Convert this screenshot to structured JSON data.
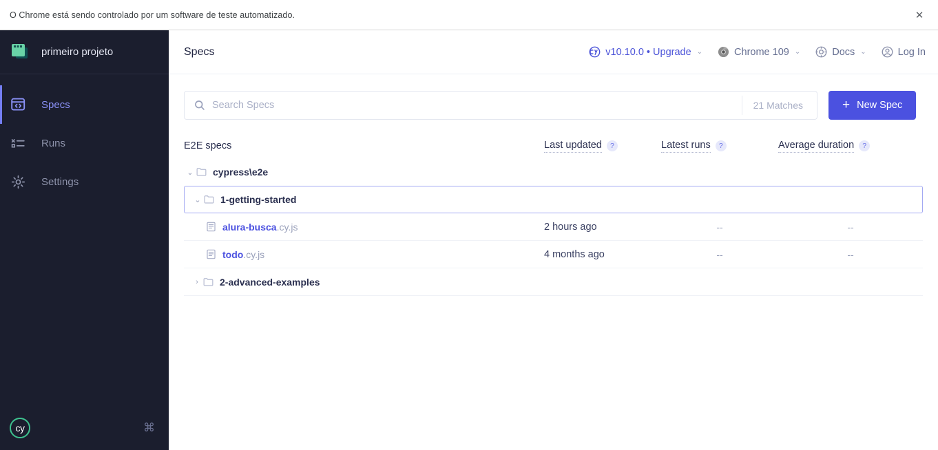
{
  "automation_bar": {
    "message": "O Chrome está sendo controlado por um software de teste automatizado.",
    "close_label": "✕"
  },
  "sidebar": {
    "project_name": "primeiro projeto",
    "project_icon": "project-window-icon",
    "nav_items": [
      {
        "label": "Specs",
        "icon": "specs-code-window-icon",
        "active": true
      },
      {
        "label": "Runs",
        "icon": "runs-list-icon",
        "active": false
      },
      {
        "label": "Settings",
        "icon": "gear-icon",
        "active": false
      }
    ],
    "footer": {
      "logo_text": "cy",
      "shortcut_glyph": "⌘"
    }
  },
  "header": {
    "title": "Specs",
    "items": [
      {
        "label": "v10.10.0 • Upgrade",
        "icon": "cypress-logo-icon",
        "caret": "⌄",
        "accent": true
      },
      {
        "label": "Chrome 109",
        "icon": "chrome-browser-icon",
        "caret": "⌄",
        "accent": false
      },
      {
        "label": "Docs",
        "icon": "docs-icon",
        "caret": "⌄",
        "accent": false
      },
      {
        "label": "Log In",
        "icon": "user-account-icon",
        "caret": "",
        "accent": false
      }
    ]
  },
  "search": {
    "placeholder": "Search Specs",
    "value": "",
    "matches": "21 Matches",
    "new_spec_label": "New Spec",
    "plus_glyph": "+"
  },
  "spec_table": {
    "columns": [
      {
        "label": "E2E specs",
        "has_help": false,
        "dotted": false
      },
      {
        "label": "Last updated",
        "has_help": true,
        "dotted": true
      },
      {
        "label": "Latest runs",
        "has_help": true,
        "dotted": true
      },
      {
        "label": "Average duration",
        "has_help": true,
        "dotted": true
      }
    ],
    "help_glyph": "?",
    "rows": [
      {
        "type": "folder",
        "name": "cypress\\e2e",
        "indent": 0,
        "expanded": true,
        "chevron": "⌄",
        "focused": false
      },
      {
        "type": "folder",
        "name": "1-getting-started",
        "indent": 1,
        "expanded": true,
        "chevron": "⌄",
        "focused": true
      },
      {
        "type": "spec",
        "base_name": "alura-busca",
        "extension": ".cy.js",
        "indent": 2,
        "last_updated": "2 hours ago",
        "latest_runs": "--",
        "average_duration": "--"
      },
      {
        "type": "spec",
        "base_name": "todo",
        "extension": ".cy.js",
        "indent": 2,
        "last_updated": "4 months ago",
        "latest_runs": "--",
        "average_duration": "--"
      },
      {
        "type": "folder",
        "name": "2-advanced-examples",
        "indent": 1,
        "expanded": false,
        "chevron": "›",
        "focused": false
      }
    ]
  },
  "colors": {
    "sidebar_bg": "#1b1e2e",
    "accent_indigo": "#4b51e0",
    "nav_active": "#8a91f7",
    "logo_green": "#3ec28f",
    "project_green": "#69d3a7"
  }
}
